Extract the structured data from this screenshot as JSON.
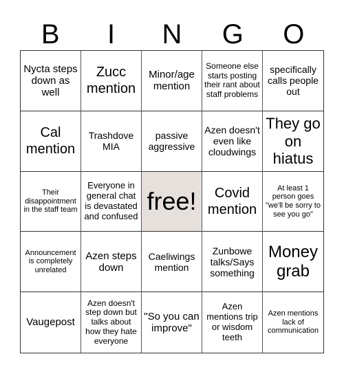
{
  "header": {
    "letters": [
      "B",
      "I",
      "N",
      "G",
      "O"
    ]
  },
  "board": {
    "free_cell_color": "#e6e0dd",
    "cells": [
      "Nycta steps down as well",
      "Zucc mention",
      "Minor/age mention",
      "Someone else starts posting their rant about staff problems",
      "specifically calls people out",
      "Cal mention",
      "Trashdove MIA",
      "passive aggressive",
      "Azen doesn't even like cloudwings",
      "They go on hiatus",
      "Their disappointment in the staff team",
      "Everyone in general chat is devastated and confused",
      "free!",
      "Covid mention",
      "At least 1 person goes \"we'll be sorry to see you go\"",
      "Announcement is completely unrelated",
      "Azen steps down",
      "Caeliwings mention",
      "Zunbowe talks/Says something",
      "Money grab",
      "Vaugepost",
      "Azen doesn't step down but talks about how they hate everyone",
      "\"So you can improve\"",
      "Azen mentions trip or wisdom teeth",
      "Azen mentions lack of communication"
    ]
  }
}
